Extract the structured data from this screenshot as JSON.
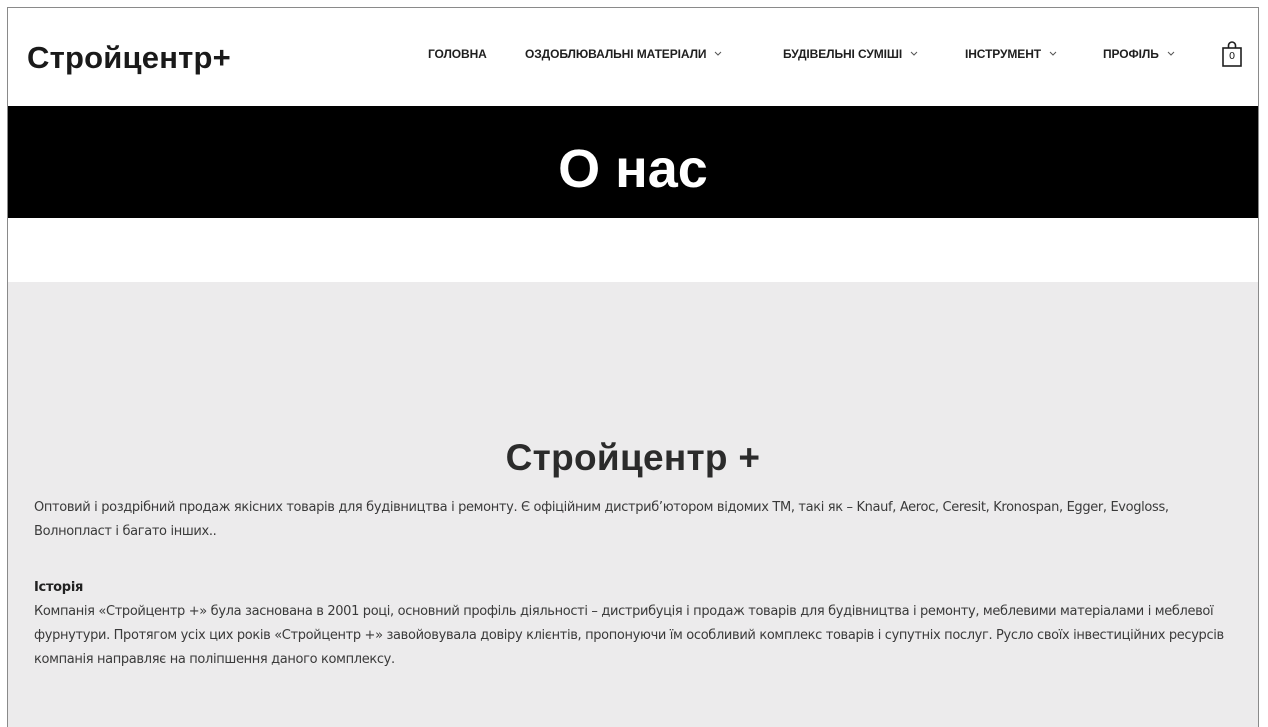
{
  "header": {
    "logo": "Стройцентр+",
    "nav": [
      {
        "label": "ГОЛОВНА",
        "has_dropdown": false
      },
      {
        "label": "ОЗДОБЛЮВАЛЬНІ МАТЕРІАЛИ",
        "has_dropdown": true
      },
      {
        "label": "БУДІВЕЛЬНІ СУМІШІ",
        "has_dropdown": true
      },
      {
        "label": "ІНСТРУМЕНТ",
        "has_dropdown": true
      },
      {
        "label": "ПРОФІЛЬ",
        "has_dropdown": true
      }
    ],
    "cart_count": "0"
  },
  "hero": {
    "title": "О нас",
    "background": "#000000"
  },
  "content": {
    "title": "Стройцентр +",
    "intro": "Оптовий і роздрібний продаж якісних товарів для будівництва і ремонту. Є офіційним дистриб’ютором відомих ТМ, такі як – Knauf, Aeroc, Ceresit, Kronospan, Egger, Evogloss, Волнопласт і багато інших..",
    "history_heading": "Історія",
    "history_text": "Компанія «Стройцентр +» була заснована в 2001 році, основний профіль діяльності – дистрибуція і продаж товарів для будівництва і ремонту, меблевими матеріалами і меблевої фурнутури. Протягом усіх цих років «Стройцентр +» завойовувала довіру клієнтів, пропонуючи їм особливий комплекс товарів і супутніх послуг. Русло своїх інвестиційних ресурсів компанія направляє на поліпшення даного комплексу.",
    "background": "#ecebec"
  }
}
